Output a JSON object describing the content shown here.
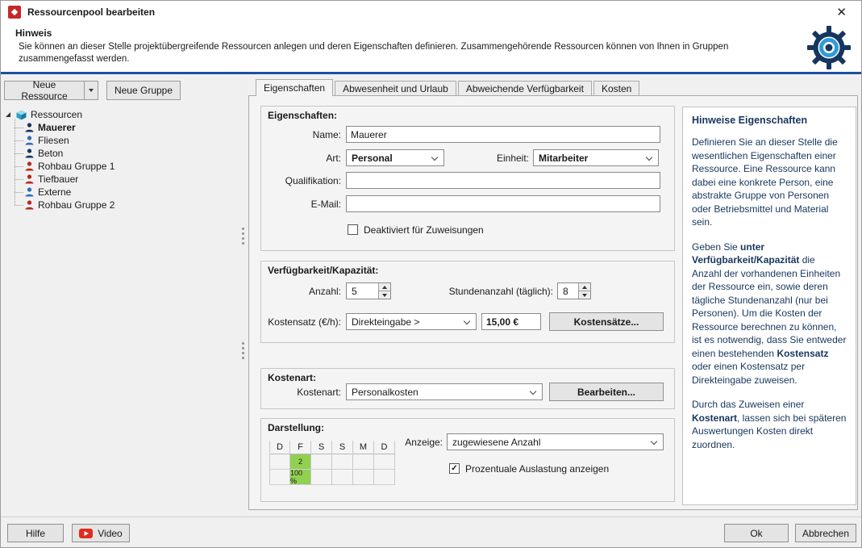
{
  "window": {
    "title": "Ressourcenpool bearbeiten"
  },
  "icons": {
    "close_glyph": "✕",
    "check_glyph": "✓"
  },
  "header": {
    "title": "Hinweis",
    "description": "Sie können an dieser Stelle projektübergreifende Ressourcen anlegen und deren Eigenschaften definieren. Zusammengehörende Ressourcen können von Ihnen in Gruppen zusammengefasst werden."
  },
  "left_panel": {
    "new_resource_button": "Neue Ressource",
    "new_group_button": "Neue Gruppe",
    "tree": {
      "root_label": "Ressourcen",
      "items": [
        {
          "label": "Mauerer",
          "icon_color": "#16355f"
        },
        {
          "label": "Fliesen",
          "icon_color": "#2f6bbf"
        },
        {
          "label": "Beton",
          "icon_color": "#16355f"
        },
        {
          "label": "Rohbau Gruppe 1",
          "icon_color": "#b5271d"
        },
        {
          "label": "Tiefbauer",
          "icon_color": "#b5271d"
        },
        {
          "label": "Externe",
          "icon_color": "#2f6bbf"
        },
        {
          "label": "Rohbau Gruppe 2",
          "icon_color": "#b5271d"
        }
      ]
    }
  },
  "tabs": {
    "tab1": "Eigenschaften",
    "tab2": "Abwesenheit und Urlaub",
    "tab3": "Abweichende Verfügbarkeit",
    "tab4": "Kosten"
  },
  "properties": {
    "caption": "Eigenschaften:",
    "name_label": "Name:",
    "name_value": "Mauerer",
    "art_label": "Art:",
    "art_value": "Personal",
    "einheit_label": "Einheit:",
    "einheit_value": "Mitarbeiter",
    "qualifikation_label": "Qualifikation:",
    "qualifikation_value": "",
    "email_label": "E-Mail:",
    "email_value": "",
    "deaktiviert_label": "Deaktiviert für Zuweisungen"
  },
  "availability": {
    "caption": "Verfügbarkeit/Kapazität:",
    "anzahl_label": "Anzahl:",
    "anzahl_value": "5",
    "stunden_label": "Stundenanzahl (täglich):",
    "stunden_value": "8",
    "kostensatz_label": "Kostensatz (€/h):",
    "kostensatz_mode": "Direkteingabe >",
    "kostensatz_value": "15,00 €",
    "kostensaetze_button": "Kostensätze..."
  },
  "kostenart": {
    "caption": "Kostenart:",
    "label": "Kostenart:",
    "value": "Personalkosten",
    "bearbeiten_button": "Bearbeiten..."
  },
  "darstellung": {
    "caption": "Darstellung:",
    "day_headers": [
      "D",
      "F",
      "S",
      "S",
      "M",
      "D"
    ],
    "cell_count": "2",
    "cell_percent": "100 %",
    "highlight_color": "#92d050",
    "anzeige_label": "Anzeige:",
    "anzeige_value": "zugewiesene Anzahl",
    "auslastung_label": "Prozentuale Auslastung anzeigen"
  },
  "help": {
    "title": "Hinweise Eigenschaften",
    "p1": "Definieren Sie an dieser Stelle die wesentlichen Eigenschaften einer Ressource. Eine Ressource kann dabei eine konkrete Person, eine abstrakte Gruppe von Personen oder Betriebsmittel und Material sein.",
    "p2_t1": "Geben Sie ",
    "p2_b1": "unter Verfügbarkeit/Kapazität",
    "p2_t2": " die Anzahl der vorhandenen Einheiten der Ressource ein, sowie deren tägliche Stundenanzahl (nur bei Personen). Um die Kosten der Ressource berechnen zu können, ist es notwendig, dass Sie entweder einen bestehenden ",
    "p2_b2": "Kostensatz",
    "p2_t3": " oder einen Kostensatz per Direkteingabe zuweisen.",
    "p3_t1": "Durch das Zuweisen einer ",
    "p3_b1": "Kostenart",
    "p3_t2": ", lassen sich bei späteren Auswertungen Kosten direkt zuordnen."
  },
  "footer": {
    "hilfe": "Hilfe",
    "video": "Video",
    "ok": "Ok",
    "abbrechen": "Abbrechen"
  },
  "colors": {
    "accent": "#1d4fa1",
    "highlight_green": "#92d050",
    "help_text": "#17365d"
  }
}
